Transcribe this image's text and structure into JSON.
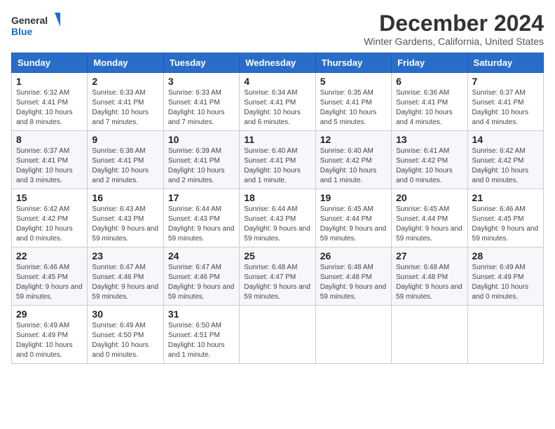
{
  "logo": {
    "text_general": "General",
    "text_blue": "Blue"
  },
  "title": "December 2024",
  "subtitle": "Winter Gardens, California, United States",
  "headers": [
    "Sunday",
    "Monday",
    "Tuesday",
    "Wednesday",
    "Thursday",
    "Friday",
    "Saturday"
  ],
  "weeks": [
    [
      {
        "day": "1",
        "sunrise": "6:32 AM",
        "sunset": "4:41 PM",
        "daylight": "10 hours and 8 minutes."
      },
      {
        "day": "2",
        "sunrise": "6:33 AM",
        "sunset": "4:41 PM",
        "daylight": "10 hours and 7 minutes."
      },
      {
        "day": "3",
        "sunrise": "6:33 AM",
        "sunset": "4:41 PM",
        "daylight": "10 hours and 7 minutes."
      },
      {
        "day": "4",
        "sunrise": "6:34 AM",
        "sunset": "4:41 PM",
        "daylight": "10 hours and 6 minutes."
      },
      {
        "day": "5",
        "sunrise": "6:35 AM",
        "sunset": "4:41 PM",
        "daylight": "10 hours and 5 minutes."
      },
      {
        "day": "6",
        "sunrise": "6:36 AM",
        "sunset": "4:41 PM",
        "daylight": "10 hours and 4 minutes."
      },
      {
        "day": "7",
        "sunrise": "6:37 AM",
        "sunset": "4:41 PM",
        "daylight": "10 hours and 4 minutes."
      }
    ],
    [
      {
        "day": "8",
        "sunrise": "6:37 AM",
        "sunset": "4:41 PM",
        "daylight": "10 hours and 3 minutes."
      },
      {
        "day": "9",
        "sunrise": "6:38 AM",
        "sunset": "4:41 PM",
        "daylight": "10 hours and 2 minutes."
      },
      {
        "day": "10",
        "sunrise": "6:39 AM",
        "sunset": "4:41 PM",
        "daylight": "10 hours and 2 minutes."
      },
      {
        "day": "11",
        "sunrise": "6:40 AM",
        "sunset": "4:41 PM",
        "daylight": "10 hours and 1 minute."
      },
      {
        "day": "12",
        "sunrise": "6:40 AM",
        "sunset": "4:42 PM",
        "daylight": "10 hours and 1 minute."
      },
      {
        "day": "13",
        "sunrise": "6:41 AM",
        "sunset": "4:42 PM",
        "daylight": "10 hours and 0 minutes."
      },
      {
        "day": "14",
        "sunrise": "6:42 AM",
        "sunset": "4:42 PM",
        "daylight": "10 hours and 0 minutes."
      }
    ],
    [
      {
        "day": "15",
        "sunrise": "6:42 AM",
        "sunset": "4:42 PM",
        "daylight": "10 hours and 0 minutes."
      },
      {
        "day": "16",
        "sunrise": "6:43 AM",
        "sunset": "4:43 PM",
        "daylight": "9 hours and 59 minutes."
      },
      {
        "day": "17",
        "sunrise": "6:44 AM",
        "sunset": "4:43 PM",
        "daylight": "9 hours and 59 minutes."
      },
      {
        "day": "18",
        "sunrise": "6:44 AM",
        "sunset": "4:43 PM",
        "daylight": "9 hours and 59 minutes."
      },
      {
        "day": "19",
        "sunrise": "6:45 AM",
        "sunset": "4:44 PM",
        "daylight": "9 hours and 59 minutes."
      },
      {
        "day": "20",
        "sunrise": "6:45 AM",
        "sunset": "4:44 PM",
        "daylight": "9 hours and 59 minutes."
      },
      {
        "day": "21",
        "sunrise": "6:46 AM",
        "sunset": "4:45 PM",
        "daylight": "9 hours and 59 minutes."
      }
    ],
    [
      {
        "day": "22",
        "sunrise": "6:46 AM",
        "sunset": "4:45 PM",
        "daylight": "9 hours and 59 minutes."
      },
      {
        "day": "23",
        "sunrise": "6:47 AM",
        "sunset": "4:46 PM",
        "daylight": "9 hours and 59 minutes."
      },
      {
        "day": "24",
        "sunrise": "6:47 AM",
        "sunset": "4:46 PM",
        "daylight": "9 hours and 59 minutes."
      },
      {
        "day": "25",
        "sunrise": "6:48 AM",
        "sunset": "4:47 PM",
        "daylight": "9 hours and 59 minutes."
      },
      {
        "day": "26",
        "sunrise": "6:48 AM",
        "sunset": "4:48 PM",
        "daylight": "9 hours and 59 minutes."
      },
      {
        "day": "27",
        "sunrise": "6:48 AM",
        "sunset": "4:48 PM",
        "daylight": "9 hours and 59 minutes."
      },
      {
        "day": "28",
        "sunrise": "6:49 AM",
        "sunset": "4:49 PM",
        "daylight": "10 hours and 0 minutes."
      }
    ],
    [
      {
        "day": "29",
        "sunrise": "6:49 AM",
        "sunset": "4:49 PM",
        "daylight": "10 hours and 0 minutes."
      },
      {
        "day": "30",
        "sunrise": "6:49 AM",
        "sunset": "4:50 PM",
        "daylight": "10 hours and 0 minutes."
      },
      {
        "day": "31",
        "sunrise": "6:50 AM",
        "sunset": "4:51 PM",
        "daylight": "10 hours and 1 minute."
      },
      null,
      null,
      null,
      null
    ]
  ],
  "labels": {
    "sunrise": "Sunrise:",
    "sunset": "Sunset:",
    "daylight": "Daylight:"
  }
}
